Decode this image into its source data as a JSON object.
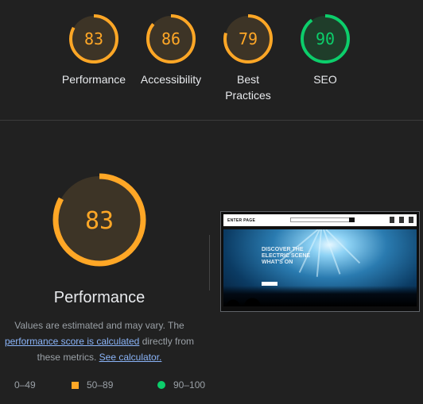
{
  "categories": [
    {
      "name": "Performance",
      "score": "83",
      "value": 83,
      "color": "#ffa726",
      "track": "#3d3426"
    },
    {
      "name": "Accessibility",
      "score": "86",
      "value": 86,
      "color": "#ffa726",
      "track": "#3d3426"
    },
    {
      "name": "Best Practices",
      "score": "79",
      "value": 79,
      "color": "#ffa726",
      "track": "#3d3426"
    },
    {
      "name": "SEO",
      "score": "90",
      "value": 90,
      "color": "#0cce6b",
      "track": "#1f3d2a"
    }
  ],
  "main": {
    "title": "Performance",
    "score": "83",
    "value": 83,
    "color": "#ffa726",
    "track": "#3d3426",
    "description_prefix": "Values are estimated and may vary. The ",
    "description_link": "performance score is calculated",
    "description_middle": " directly from these metrics. ",
    "calculator_link": "See calculator."
  },
  "legend": [
    {
      "range": "0–49",
      "color": "#ff4e42",
      "icon": "triangle-icon"
    },
    {
      "range": "50–89",
      "color": "#ffa726",
      "icon": "square-icon"
    },
    {
      "range": "90–100",
      "color": "#0cce6b",
      "icon": "circle-icon"
    }
  ],
  "screenshot": {
    "logo": "ENTER PAGE",
    "hero_line1": "DISCOVER THE",
    "hero_line2": "ELECTRIC SCENE",
    "hero_line3": "WHAT'S ON"
  }
}
